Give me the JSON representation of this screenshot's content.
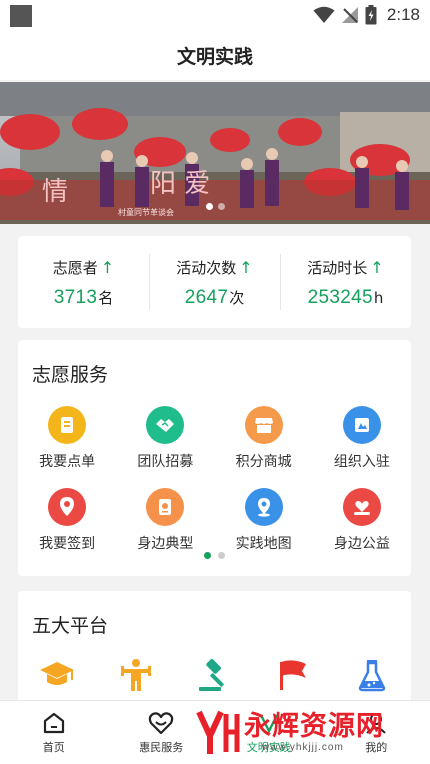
{
  "status_bar": {
    "time": "2:18"
  },
  "header": {
    "title": "文明实践"
  },
  "banner": {
    "slides": 2,
    "active_slide": 1,
    "text_overlay": "情",
    "text_overlay_2": "阳 爱",
    "caption": "村童同节革谈会"
  },
  "stats": [
    {
      "label": "志愿者",
      "arrow": "↑",
      "value": "3713",
      "unit": "名"
    },
    {
      "label": "活动次数",
      "arrow": "↑",
      "value": "2647",
      "unit": "次"
    },
    {
      "label": "活动时长",
      "arrow": "↑",
      "value": "253245",
      "unit": "h"
    }
  ],
  "service": {
    "title": "志愿服务",
    "items": [
      {
        "label": "我要点单",
        "icon": "order-icon",
        "color": "#f4b51b"
      },
      {
        "label": "团队招募",
        "icon": "handshake-icon",
        "color": "#1fbc8c"
      },
      {
        "label": "积分商城",
        "icon": "shop-icon",
        "color": "#f59a4a"
      },
      {
        "label": "组织入驻",
        "icon": "register-icon",
        "color": "#3a92e8"
      },
      {
        "label": "我要签到",
        "icon": "location-pin-icon",
        "color": "#ea4a43"
      },
      {
        "label": "身边典型",
        "icon": "certificate-icon",
        "color": "#f5914a"
      },
      {
        "label": "实践地图",
        "icon": "map-marker-icon",
        "color": "#3a92e8"
      },
      {
        "label": "身边公益",
        "icon": "charity-icon",
        "color": "#ea4a43"
      }
    ],
    "pages": 2,
    "active_page": 1
  },
  "platform": {
    "title": "五大平台",
    "items": [
      {
        "icon": "graduation-cap-icon",
        "color": "#f5a623"
      },
      {
        "icon": "fitness-icon",
        "color": "#f5a623"
      },
      {
        "icon": "gavel-icon",
        "color": "#1fa888"
      },
      {
        "icon": "flag-icon",
        "color": "#e8352e"
      },
      {
        "icon": "flask-icon",
        "color": "#3a7ee8"
      }
    ]
  },
  "tabbar": {
    "items": [
      {
        "label": "首页",
        "icon": "home-icon",
        "active": false
      },
      {
        "label": "惠民服务",
        "icon": "smile-heart-icon",
        "active": false
      },
      {
        "label": "文明实践",
        "icon": "practice-icon",
        "active": true
      },
      {
        "label": "我的",
        "icon": "user-icon",
        "active": false
      }
    ]
  },
  "watermark": {
    "text": "永辉资源网",
    "url": "www.yhkjjj.com"
  },
  "colors": {
    "accent": "#16a05d",
    "background": "#f2f2f2",
    "watermark": "#e8202a"
  }
}
